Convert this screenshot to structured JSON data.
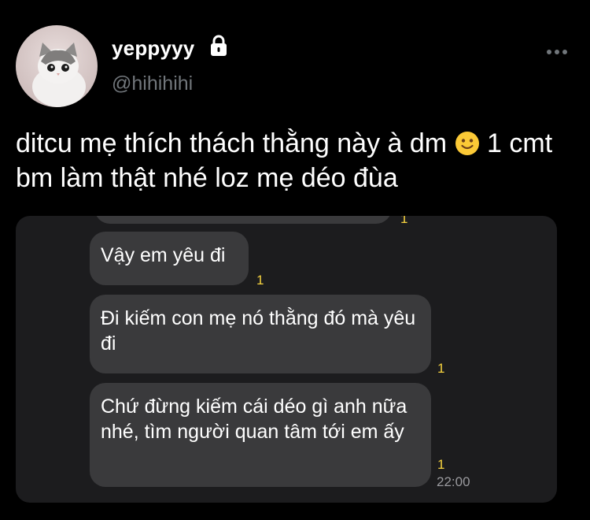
{
  "author": {
    "display_name": "yeppyyy",
    "handle": "@hihihihi",
    "avatar_icon": "kitten-avatar",
    "protected_icon": "lock-icon"
  },
  "menu": {
    "icon": "more-horizontal-icon"
  },
  "tweet": {
    "text_part1": "ditcu mẹ thích thách thằng này à dm",
    "emoji_icon": "slightly-smiling-face-icon",
    "text_part2": "1 cmt bm làm thật nhé loz mẹ déo đùa"
  },
  "screenshot": {
    "messages": [
      {
        "text": "Vậy em yêu đi",
        "read": "1"
      },
      {
        "text": "Đi kiếm con mẹ nó thằng đó mà yêu đi",
        "read": "1"
      },
      {
        "text": "Chứ đừng kiếm cái déo gì anh nữa nhé, tìm người quan tâm tới em ấy",
        "read": "1",
        "time": "22:00"
      }
    ],
    "partial_read": "1"
  },
  "colors": {
    "background": "#000000",
    "text": "#ffffff",
    "muted": "#71767b",
    "bubble": "#3a3a3c",
    "read_badge": "#f6d23f"
  }
}
